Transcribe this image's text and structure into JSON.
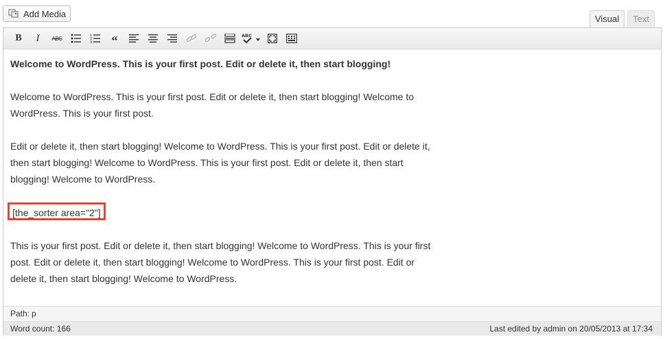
{
  "media": {
    "add_label": "Add Media"
  },
  "tabs": [
    {
      "label": "Visual"
    },
    {
      "label": "Text"
    }
  ],
  "toolbar": {
    "bold": "B",
    "italic": "I",
    "strike": "ABC",
    "quote": "“"
  },
  "content": {
    "p1": "Welcome to WordPress. This is your first post. Edit or delete it, then start blogging!",
    "p2a": "Welcome to WordPress. This is your first post. Edit or delete it, then start blogging! Welcome to",
    "p2b": "WordPress. This is your first post.",
    "p3a": "Edit or delete it, then start blogging! Welcome to WordPress. This is your first post. Edit or delete it,",
    "p3b": "then start blogging! Welcome to WordPress. This is your first post. Edit or delete it, then start",
    "p3c": "blogging! Welcome to WordPress.",
    "shortcode": "[the_sorter area=\"2\"]",
    "p4a": "This is your first post. Edit or delete it, then start blogging! Welcome to WordPress. This is your first",
    "p4b": "post. Edit or delete it, then start blogging! Welcome to WordPress. This is your first post. Edit or",
    "p4c": "delete it, then start blogging! Welcome to WordPress."
  },
  "path": {
    "label": "Path:",
    "value": "p"
  },
  "status": {
    "word_count": "Word count: 166",
    "last_edited": "Last edited by admin on 20/05/2013 at 17:34"
  }
}
